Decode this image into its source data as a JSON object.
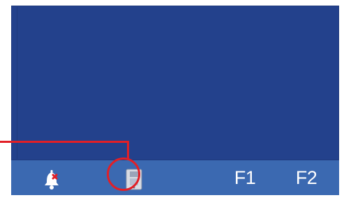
{
  "screen": {
    "background_color": "#23418c"
  },
  "taskbar": {
    "background_color": "#3b69b1",
    "items": [
      {
        "name": "alarm-bell",
        "icon": "bell-icon"
      },
      {
        "name": "device",
        "icon": "device-icon"
      },
      {
        "name": "f1",
        "label": "F1"
      },
      {
        "name": "f2",
        "label": "F2"
      }
    ]
  },
  "callout": {
    "color": "#e21f26",
    "target": "device-icon"
  }
}
